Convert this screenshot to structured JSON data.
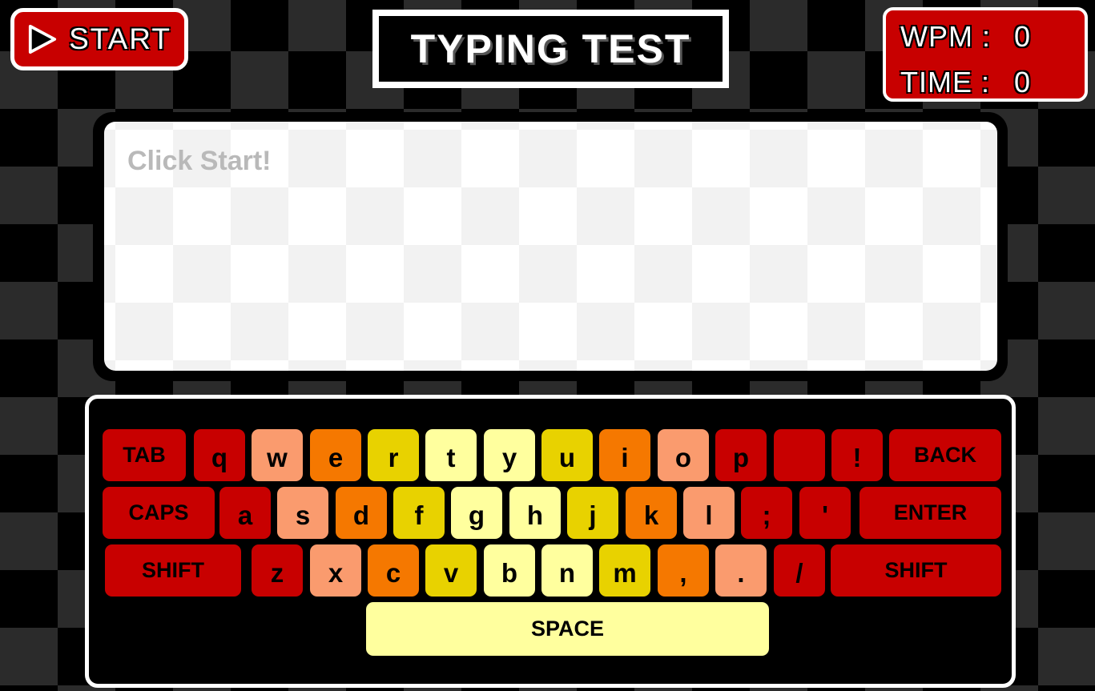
{
  "header": {
    "start_label": "START",
    "title": "TYPING TEST",
    "stats": {
      "wpm_label": "WPM :",
      "wpm_value": "0",
      "time_label": "TIME :",
      "time_value": "0"
    }
  },
  "text_area": {
    "prompt": "Click Start!"
  },
  "colors": {
    "red": "#c80000",
    "salmon": "#fa9b6e",
    "orange": "#f57800",
    "yellow": "#e8d200",
    "light_yellow": "#ffff9e",
    "placeholder_gray": "#b9b9b9"
  },
  "keyboard": {
    "row1": [
      {
        "label": "TAB",
        "name": "tab",
        "color": "#c80000"
      },
      {
        "label": "q",
        "name": "q",
        "color": "#c80000"
      },
      {
        "label": "w",
        "name": "w",
        "color": "#fa9b6e"
      },
      {
        "label": "e",
        "name": "e",
        "color": "#f57800"
      },
      {
        "label": "r",
        "name": "r",
        "color": "#e8d200"
      },
      {
        "label": "t",
        "name": "t",
        "color": "#ffff9e"
      },
      {
        "label": "y",
        "name": "y",
        "color": "#ffff9e"
      },
      {
        "label": "u",
        "name": "u",
        "color": "#e8d200"
      },
      {
        "label": "i",
        "name": "i",
        "color": "#f57800"
      },
      {
        "label": "o",
        "name": "o",
        "color": "#fa9b6e"
      },
      {
        "label": "p",
        "name": "p",
        "color": "#c80000"
      },
      {
        "label": "",
        "name": "blank",
        "color": "#c80000"
      },
      {
        "label": "!",
        "name": "exclamation",
        "color": "#c80000"
      },
      {
        "label": "BACK",
        "name": "back",
        "color": "#c80000"
      }
    ],
    "row2": [
      {
        "label": "CAPS",
        "name": "caps",
        "color": "#c80000"
      },
      {
        "label": "a",
        "name": "a",
        "color": "#c80000"
      },
      {
        "label": "s",
        "name": "s",
        "color": "#fa9b6e"
      },
      {
        "label": "d",
        "name": "d",
        "color": "#f57800"
      },
      {
        "label": "f",
        "name": "f",
        "color": "#e8d200"
      },
      {
        "label": "g",
        "name": "g",
        "color": "#ffff9e"
      },
      {
        "label": "h",
        "name": "h",
        "color": "#ffff9e"
      },
      {
        "label": "j",
        "name": "j",
        "color": "#e8d200"
      },
      {
        "label": "k",
        "name": "k",
        "color": "#f57800"
      },
      {
        "label": "l",
        "name": "l",
        "color": "#fa9b6e"
      },
      {
        "label": ";",
        "name": "semicolon",
        "color": "#c80000"
      },
      {
        "label": "'",
        "name": "apostrophe",
        "color": "#c80000"
      },
      {
        "label": "ENTER",
        "name": "enter",
        "color": "#c80000"
      }
    ],
    "row3": [
      {
        "label": "SHIFT",
        "name": "shift-left",
        "color": "#c80000"
      },
      {
        "label": "z",
        "name": "z",
        "color": "#c80000"
      },
      {
        "label": "x",
        "name": "x",
        "color": "#fa9b6e"
      },
      {
        "label": "c",
        "name": "c",
        "color": "#f57800"
      },
      {
        "label": "v",
        "name": "v",
        "color": "#e8d200"
      },
      {
        "label": "b",
        "name": "b",
        "color": "#ffff9e"
      },
      {
        "label": "n",
        "name": "n",
        "color": "#ffff9e"
      },
      {
        "label": "m",
        "name": "m",
        "color": "#e8d200"
      },
      {
        "label": ",",
        "name": "comma",
        "color": "#f57800"
      },
      {
        "label": ".",
        "name": "period",
        "color": "#fa9b6e"
      },
      {
        "label": "/",
        "name": "slash",
        "color": "#c80000"
      },
      {
        "label": "SHIFT",
        "name": "shift-right",
        "color": "#c80000"
      }
    ],
    "row4": [
      {
        "label": "SPACE",
        "name": "space",
        "color": "#ffff9e"
      }
    ]
  }
}
